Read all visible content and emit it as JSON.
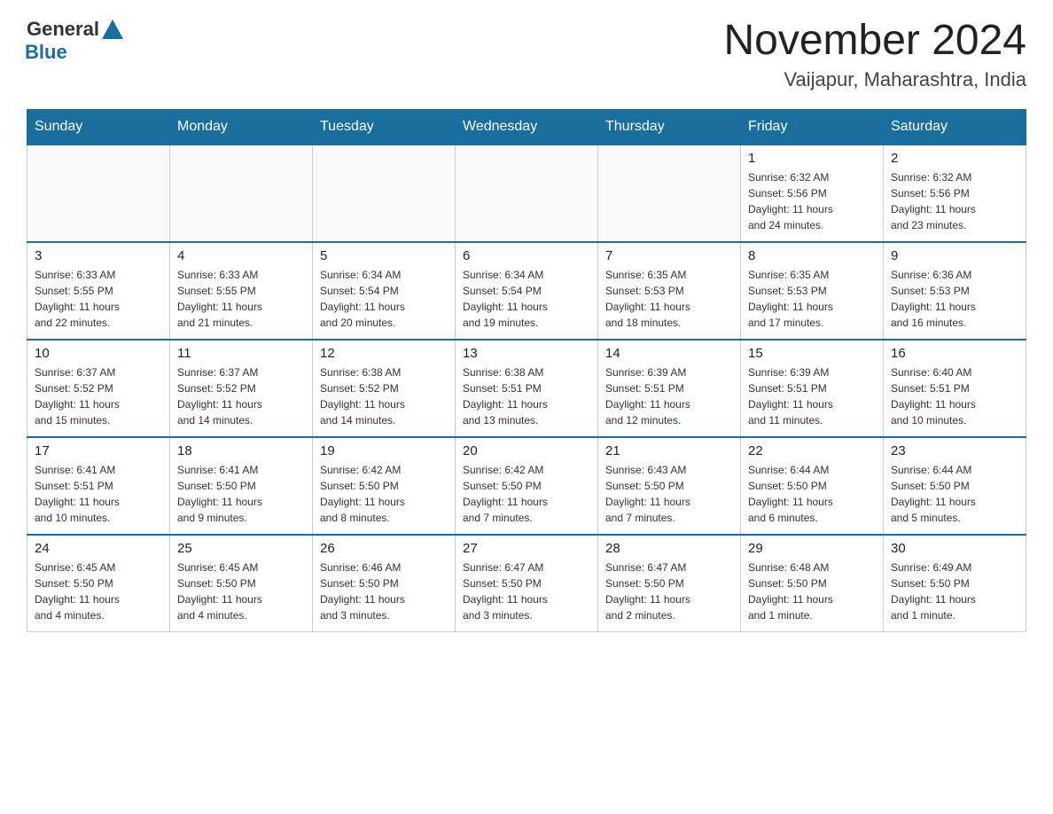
{
  "header": {
    "logo_general": "General",
    "logo_blue": "Blue",
    "month_title": "November 2024",
    "location": "Vaijapur, Maharashtra, India"
  },
  "weekdays": [
    "Sunday",
    "Monday",
    "Tuesday",
    "Wednesday",
    "Thursday",
    "Friday",
    "Saturday"
  ],
  "weeks": [
    [
      {
        "day": "",
        "info": ""
      },
      {
        "day": "",
        "info": ""
      },
      {
        "day": "",
        "info": ""
      },
      {
        "day": "",
        "info": ""
      },
      {
        "day": "",
        "info": ""
      },
      {
        "day": "1",
        "info": "Sunrise: 6:32 AM\nSunset: 5:56 PM\nDaylight: 11 hours\nand 24 minutes."
      },
      {
        "day": "2",
        "info": "Sunrise: 6:32 AM\nSunset: 5:56 PM\nDaylight: 11 hours\nand 23 minutes."
      }
    ],
    [
      {
        "day": "3",
        "info": "Sunrise: 6:33 AM\nSunset: 5:55 PM\nDaylight: 11 hours\nand 22 minutes."
      },
      {
        "day": "4",
        "info": "Sunrise: 6:33 AM\nSunset: 5:55 PM\nDaylight: 11 hours\nand 21 minutes."
      },
      {
        "day": "5",
        "info": "Sunrise: 6:34 AM\nSunset: 5:54 PM\nDaylight: 11 hours\nand 20 minutes."
      },
      {
        "day": "6",
        "info": "Sunrise: 6:34 AM\nSunset: 5:54 PM\nDaylight: 11 hours\nand 19 minutes."
      },
      {
        "day": "7",
        "info": "Sunrise: 6:35 AM\nSunset: 5:53 PM\nDaylight: 11 hours\nand 18 minutes."
      },
      {
        "day": "8",
        "info": "Sunrise: 6:35 AM\nSunset: 5:53 PM\nDaylight: 11 hours\nand 17 minutes."
      },
      {
        "day": "9",
        "info": "Sunrise: 6:36 AM\nSunset: 5:53 PM\nDaylight: 11 hours\nand 16 minutes."
      }
    ],
    [
      {
        "day": "10",
        "info": "Sunrise: 6:37 AM\nSunset: 5:52 PM\nDaylight: 11 hours\nand 15 minutes."
      },
      {
        "day": "11",
        "info": "Sunrise: 6:37 AM\nSunset: 5:52 PM\nDaylight: 11 hours\nand 14 minutes."
      },
      {
        "day": "12",
        "info": "Sunrise: 6:38 AM\nSunset: 5:52 PM\nDaylight: 11 hours\nand 14 minutes."
      },
      {
        "day": "13",
        "info": "Sunrise: 6:38 AM\nSunset: 5:51 PM\nDaylight: 11 hours\nand 13 minutes."
      },
      {
        "day": "14",
        "info": "Sunrise: 6:39 AM\nSunset: 5:51 PM\nDaylight: 11 hours\nand 12 minutes."
      },
      {
        "day": "15",
        "info": "Sunrise: 6:39 AM\nSunset: 5:51 PM\nDaylight: 11 hours\nand 11 minutes."
      },
      {
        "day": "16",
        "info": "Sunrise: 6:40 AM\nSunset: 5:51 PM\nDaylight: 11 hours\nand 10 minutes."
      }
    ],
    [
      {
        "day": "17",
        "info": "Sunrise: 6:41 AM\nSunset: 5:51 PM\nDaylight: 11 hours\nand 10 minutes."
      },
      {
        "day": "18",
        "info": "Sunrise: 6:41 AM\nSunset: 5:50 PM\nDaylight: 11 hours\nand 9 minutes."
      },
      {
        "day": "19",
        "info": "Sunrise: 6:42 AM\nSunset: 5:50 PM\nDaylight: 11 hours\nand 8 minutes."
      },
      {
        "day": "20",
        "info": "Sunrise: 6:42 AM\nSunset: 5:50 PM\nDaylight: 11 hours\nand 7 minutes."
      },
      {
        "day": "21",
        "info": "Sunrise: 6:43 AM\nSunset: 5:50 PM\nDaylight: 11 hours\nand 7 minutes."
      },
      {
        "day": "22",
        "info": "Sunrise: 6:44 AM\nSunset: 5:50 PM\nDaylight: 11 hours\nand 6 minutes."
      },
      {
        "day": "23",
        "info": "Sunrise: 6:44 AM\nSunset: 5:50 PM\nDaylight: 11 hours\nand 5 minutes."
      }
    ],
    [
      {
        "day": "24",
        "info": "Sunrise: 6:45 AM\nSunset: 5:50 PM\nDaylight: 11 hours\nand 4 minutes."
      },
      {
        "day": "25",
        "info": "Sunrise: 6:45 AM\nSunset: 5:50 PM\nDaylight: 11 hours\nand 4 minutes."
      },
      {
        "day": "26",
        "info": "Sunrise: 6:46 AM\nSunset: 5:50 PM\nDaylight: 11 hours\nand 3 minutes."
      },
      {
        "day": "27",
        "info": "Sunrise: 6:47 AM\nSunset: 5:50 PM\nDaylight: 11 hours\nand 3 minutes."
      },
      {
        "day": "28",
        "info": "Sunrise: 6:47 AM\nSunset: 5:50 PM\nDaylight: 11 hours\nand 2 minutes."
      },
      {
        "day": "29",
        "info": "Sunrise: 6:48 AM\nSunset: 5:50 PM\nDaylight: 11 hours\nand 1 minute."
      },
      {
        "day": "30",
        "info": "Sunrise: 6:49 AM\nSunset: 5:50 PM\nDaylight: 11 hours\nand 1 minute."
      }
    ]
  ]
}
